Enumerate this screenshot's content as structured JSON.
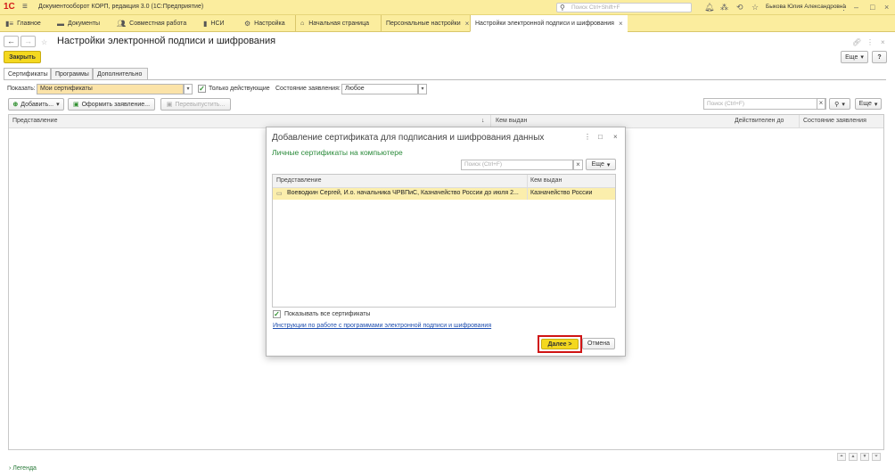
{
  "titlebar": {
    "logo": "1С",
    "title": "Документооборот КОРП, редакция 3.0  (1С:Предприятие)",
    "search_placeholder": "Поиск Ctrl+Shift+F",
    "user": "Быкова Юлия Александровна",
    "window_buttons": [
      "–",
      "□",
      "×"
    ]
  },
  "sections": [
    {
      "icon": "menu-icon",
      "label": "Главное"
    },
    {
      "icon": "folder-icon",
      "label": "Документы"
    },
    {
      "icon": "people-icon",
      "label": "Совместная работа"
    },
    {
      "icon": "book-icon",
      "label": "НСИ"
    },
    {
      "icon": "gear-icon",
      "label": "Настройка"
    }
  ],
  "page_tabs": [
    {
      "label": "Начальная страница",
      "closable": false
    },
    {
      "label": "Персональные настройки",
      "closable": true
    },
    {
      "label": "Настройки электронной подписи и шифрования",
      "closable": true,
      "active": true
    }
  ],
  "form": {
    "title": "Настройки электронной подписи и шифрования",
    "close_label": "Закрыть",
    "more_label": "Еще",
    "help_label": "?",
    "tabs": [
      "Сертификаты",
      "Программы",
      "Дополнительно"
    ],
    "show_label": "Показать:",
    "show_value": "Мои сертификаты",
    "only_valid_label": "Только действующие",
    "only_valid_checked": true,
    "state_label": "Состояние заявления:",
    "state_value": "Любое",
    "add_label": "Добавить...",
    "apply_label": "Оформить заявление...",
    "reissue_label": "Перевыпустить...",
    "search_placeholder": "Поиск (Ctrl+F)",
    "columns": [
      "Представление",
      "Кем выдан",
      "Действителен до",
      "Состояние заявления"
    ],
    "legend_label": "Легенда"
  },
  "dialog": {
    "title": "Добавление сертификата для подписания и шифрования данных",
    "subtitle": "Личные сертификаты на компьютере",
    "search_placeholder": "Поиск (Ctrl+F)",
    "more_label": "Еще",
    "columns": [
      "Представление",
      "Кем выдан"
    ],
    "rows": [
      {
        "name": "Воеводкин Сергей, И.о. начальника ЧРВПиС, Казначейство России до июля 2...",
        "issuer": "Казначейство России"
      }
    ],
    "show_all_label": "Показывать все сертификаты",
    "show_all_checked": true,
    "instruction_link": "Инструкции по работе с программами электронной подписи и шифрования",
    "next_label": "Далее >",
    "cancel_label": "Отмена"
  }
}
